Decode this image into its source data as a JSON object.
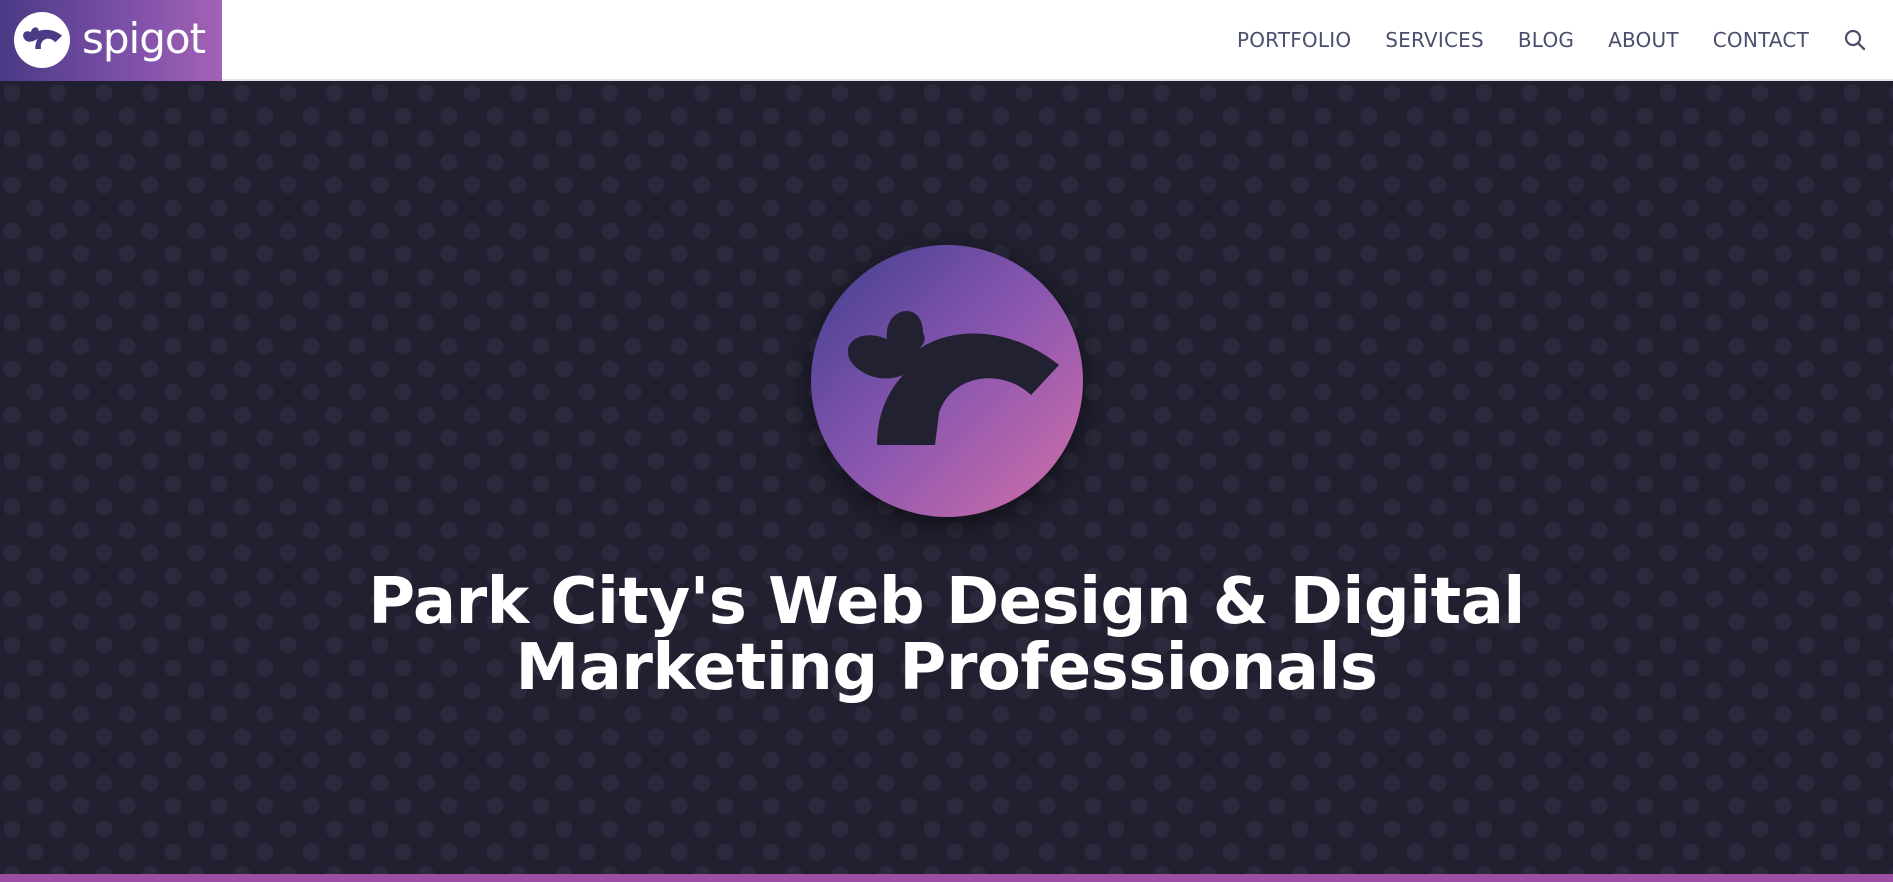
{
  "brand": {
    "name": "spigot",
    "logo_icon": "spigot-bird-icon"
  },
  "nav": {
    "items": [
      {
        "label": "PORTFOLIO"
      },
      {
        "label": "SERVICES"
      },
      {
        "label": "BLOG"
      },
      {
        "label": "ABOUT"
      },
      {
        "label": "CONTACT"
      }
    ],
    "search_icon": "search-icon"
  },
  "hero": {
    "emblem_icon": "spigot-emblem-icon",
    "title_line1": "Park City's Web Design & Digital",
    "title_line2": "Marketing Professionals"
  },
  "colors": {
    "brand_purple": "#a362b6",
    "brand_indigo": "#4b3a86",
    "hero_background": "#212030",
    "nav_text": "#4a4f6e",
    "accent_bar": "#9b4ea3"
  }
}
